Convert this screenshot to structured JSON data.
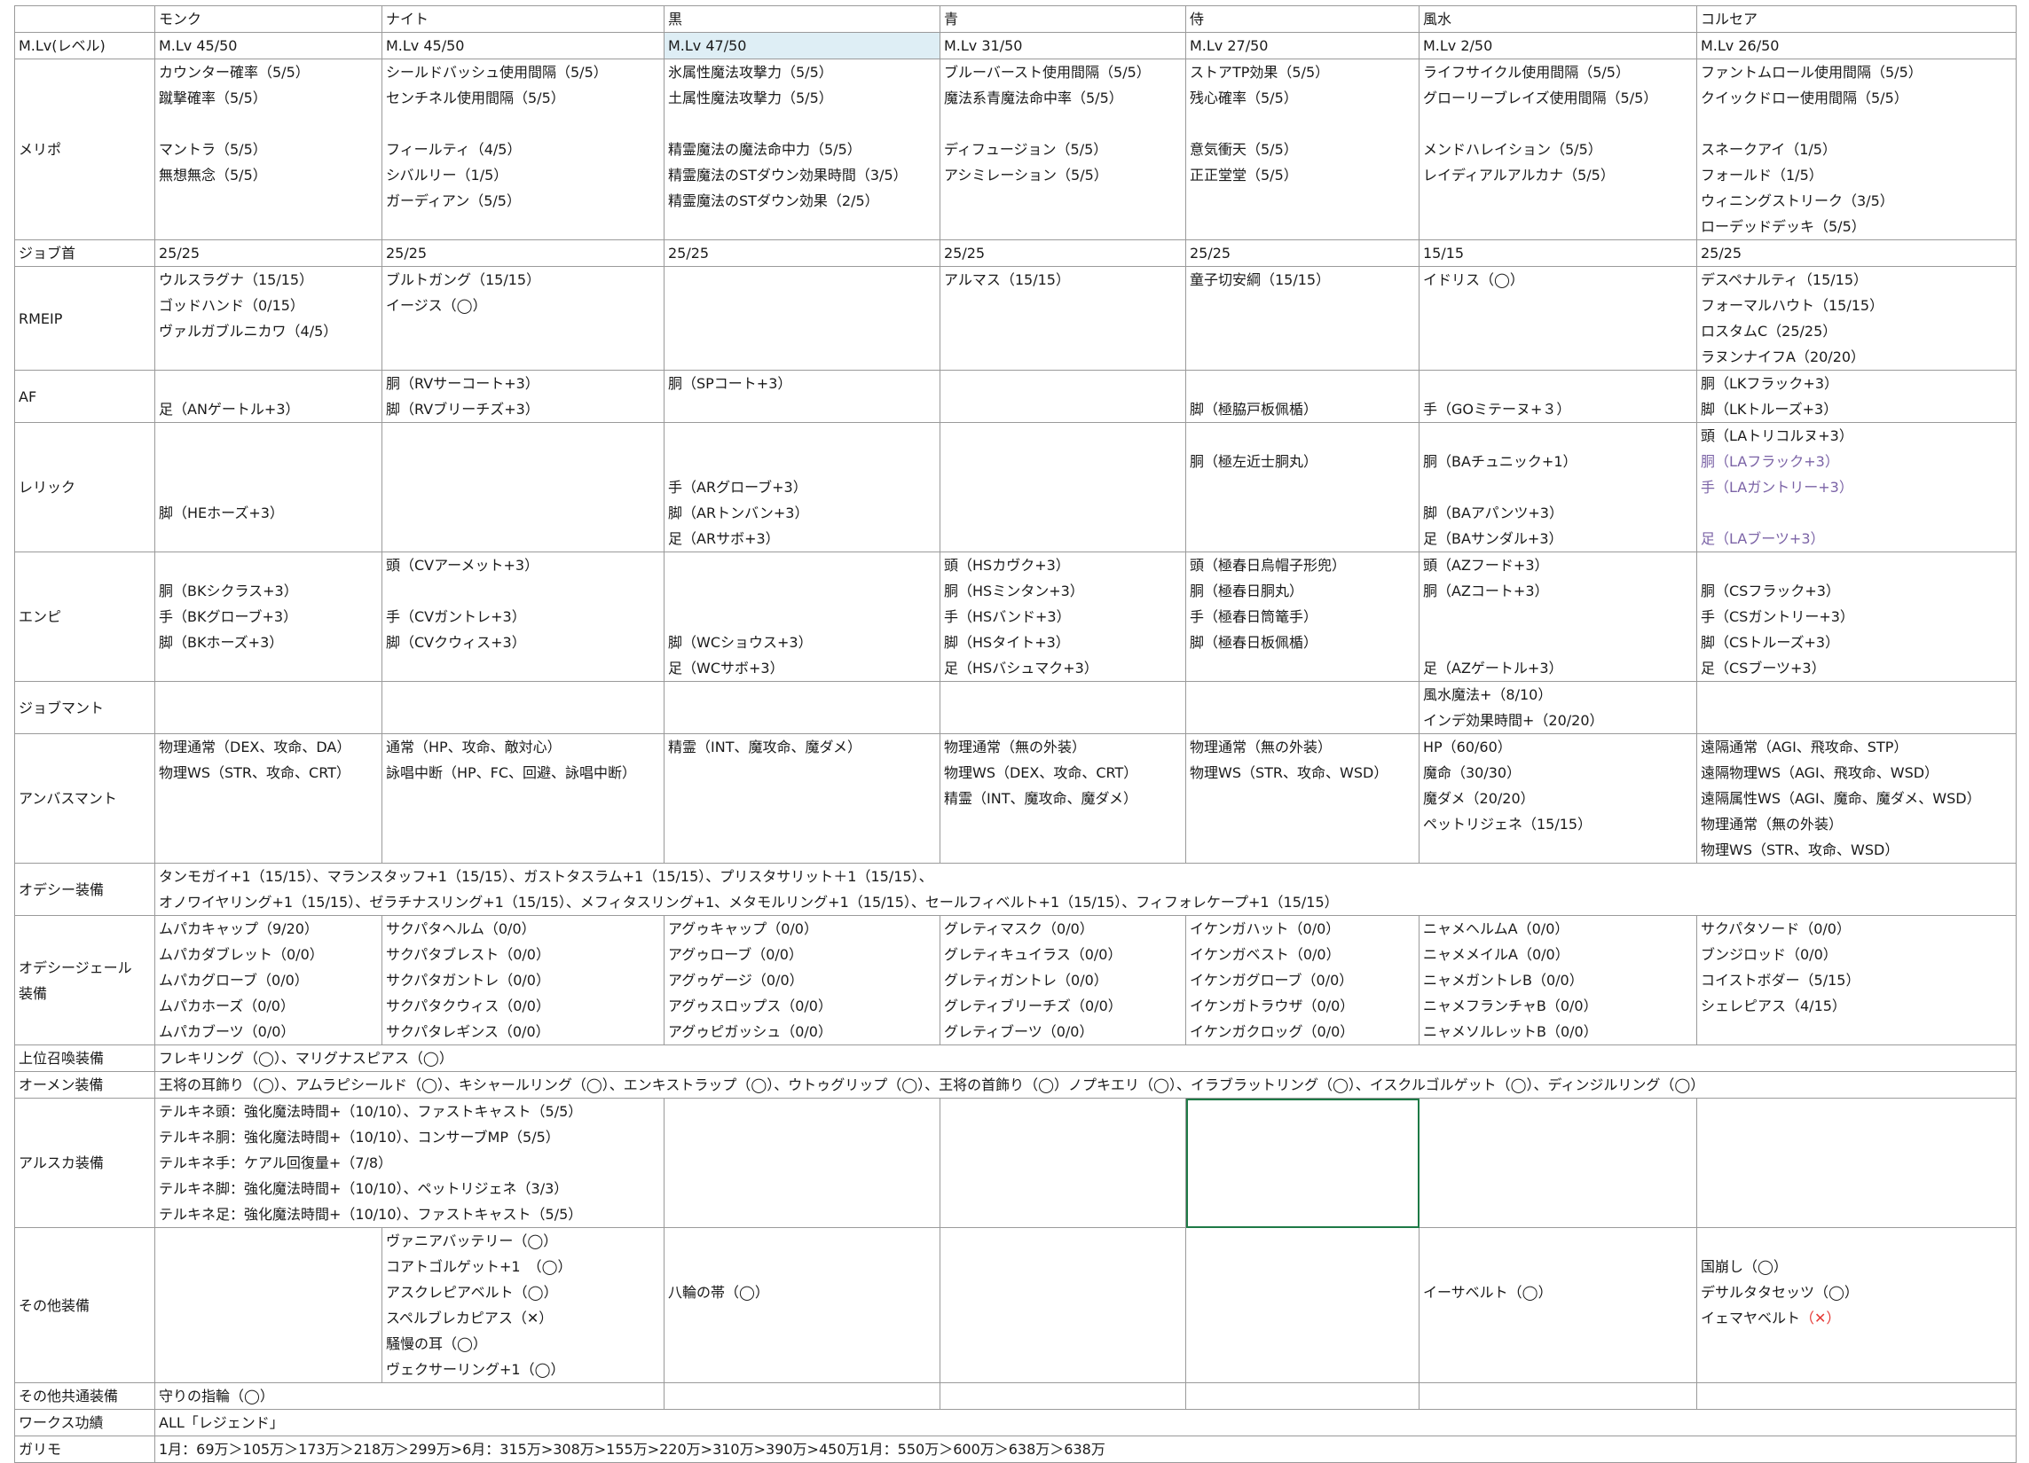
{
  "colors": {
    "highlight": "#deeef5",
    "selected_border": "#1e7a46",
    "purple_text": "#7b63a6",
    "red_mark": "#e53935",
    "grid": "#9a9a9a"
  },
  "header": {
    "corner": "",
    "jobs": [
      "モンク",
      "ナイト",
      "黒",
      "青",
      "侍",
      "風水",
      "コルセア"
    ]
  },
  "rows": [
    {
      "key": "mlv",
      "label": "M.Lv(レベル)",
      "lines": 1,
      "cells": [
        [
          "M.Lv 45/50"
        ],
        [
          "M.Lv 45/50"
        ],
        [
          "M.Lv 47/50"
        ],
        [
          "M.Lv 31/50"
        ],
        [
          "M.Lv 27/50"
        ],
        [
          "M.Lv 2/50"
        ],
        [
          "M.Lv 26/50"
        ]
      ]
    },
    {
      "key": "meripo",
      "label": "メリポ",
      "lines": 7,
      "cells": [
        [
          "カウンター確率（5/5）",
          "蹴撃確率（5/5）",
          "",
          "マントラ（5/5）",
          "無想無念（5/5）"
        ],
        [
          "シールドバッシュ使用間隔（5/5）",
          "センチネル使用間隔（5/5）",
          "",
          "フィールティ（4/5）",
          "シバルリー（1/5）",
          "ガーディアン（5/5）"
        ],
        [
          "氷属性魔法攻撃力（5/5）",
          "土属性魔法攻撃力（5/5）",
          "",
          "精霊魔法の魔法命中力（5/5）",
          "精霊魔法のSTダウン効果時間（3/5）",
          "精霊魔法のSTダウン効果（2/5）"
        ],
        [
          "ブルーバースト使用間隔（5/5）",
          "魔法系青魔法命中率（5/5）",
          "",
          "ディフュージョン（5/5）",
          "アシミレーション（5/5）"
        ],
        [
          "ストアTP効果（5/5）",
          "残心確率（5/5）",
          "",
          "意気衝天（5/5）",
          "正正堂堂（5/5）"
        ],
        [
          "ライフサイクル使用間隔（5/5）",
          "グローリーブレイズ使用間隔（5/5）",
          "",
          "メンドハレイション（5/5）",
          "レイディアルアルカナ（5/5）"
        ],
        [
          "ファントムロール使用間隔（5/5）",
          "クイックドロー使用間隔（5/5）",
          "",
          "スネークアイ（1/5）",
          "フォールド（1/5）",
          "ウィニングストリーク（3/5）",
          "ローデッドデッキ（5/5）"
        ]
      ]
    },
    {
      "key": "jobkubi",
      "label": "ジョブ首",
      "lines": 1,
      "cells": [
        [
          "25/25"
        ],
        [
          "25/25"
        ],
        [
          "25/25"
        ],
        [
          "25/25"
        ],
        [
          "25/25"
        ],
        [
          "15/15"
        ],
        [
          "25/25"
        ]
      ]
    },
    {
      "key": "rmeip",
      "label": "RMEIP",
      "lines": 4,
      "cells": [
        [
          "ウルスラグナ（15/15）",
          "ゴッドハンド（0/15）",
          "ヴァルガブルニカワ（4/5）"
        ],
        [
          "ブルトガング（15/15）",
          "イージス（◯）"
        ],
        [],
        [
          "アルマス（15/15）"
        ],
        [
          "童子切安綱（15/15）"
        ],
        [
          "イドリス（◯）"
        ],
        [
          "デスペナルティ（15/15）",
          "フォーマルハウト（15/15）",
          "ロスタムC（25/25）",
          "ラヌンナイフA（20/20）"
        ]
      ]
    },
    {
      "key": "af",
      "label": "AF",
      "lines": 2,
      "cells": [
        [
          "",
          "足（ANゲートル+3）"
        ],
        [
          "胴（RVサーコート+3）",
          "脚（RVブリーチズ+3）"
        ],
        [
          "胴（SPコート+3）",
          ""
        ],
        [],
        [
          "",
          "脚（極脇戸板佩楯）"
        ],
        [
          "",
          "手（GOミテーヌ+３）"
        ],
        [
          "胴（LKフラック+3）",
          "脚（LKトルーズ+3）"
        ]
      ]
    },
    {
      "key": "relic",
      "label": "レリック",
      "lines": 5,
      "cells": [
        [
          "",
          "",
          "",
          "脚（HEホーズ+3）",
          ""
        ],
        [],
        [
          "",
          "",
          "手（ARグローブ+3）",
          "脚（ARトンバン+3）",
          "足（ARサボ+3）"
        ],
        [],
        [
          "",
          "胴（極左近士胴丸）",
          "",
          "",
          ""
        ],
        [
          "",
          "胴（BAチュニック+1）",
          "",
          "脚（BAアパンツ+3）",
          "足（BAサンダル+3）"
        ],
        [
          "頭（LAトリコルヌ+3）",
          "§胴（LAフラック+3）",
          "§手（LAガントリー+3）",
          "",
          "§足（LAブーツ+3）"
        ]
      ]
    },
    {
      "key": "empy",
      "label": "エンピ",
      "lines": 5,
      "cells": [
        [
          "",
          "胴（BKシクラス+3）",
          "手（BKグローブ+3）",
          "脚（BKホーズ+3）",
          ""
        ],
        [
          "頭（CVアーメット+3）",
          "",
          "手（CVガントレ+3）",
          "脚（CVクウィス+3）",
          ""
        ],
        [
          "",
          "",
          "",
          "脚（WCショウス+3）",
          "足（WCサボ+3）"
        ],
        [
          "頭（HSカヴク+3）",
          "胴（HSミンタン+3）",
          "手（HSバンド+3）",
          "脚（HSタイト+3）",
          "足（HSバシュマク+3）"
        ],
        [
          "頭（極春日烏帽子形兜）",
          "胴（極春日胴丸）",
          "手（極春日筒篭手）",
          "脚（極春日板佩楯）",
          ""
        ],
        [
          "頭（AZフード+3）",
          "胴（AZコート+3）",
          "",
          "",
          "足（AZゲートル+3）"
        ],
        [
          "",
          "胴（CSフラック+3）",
          "手（CSガントリー+3）",
          "脚（CSトルーズ+3）",
          "足（CSブーツ+3）"
        ]
      ]
    },
    {
      "key": "jobmant",
      "label": "ジョブマント",
      "lines": 2,
      "cells": [
        [],
        [],
        [],
        [],
        [],
        [
          "風水魔法+（8/10）",
          "インデ効果時間+（20/20）"
        ],
        []
      ]
    },
    {
      "key": "ambus",
      "label": "アンバスマント",
      "lines": 5,
      "cells": [
        [
          "物理通常（DEX、攻命、DA）",
          "物理WS（STR、攻命、CRT）"
        ],
        [
          "通常（HP、攻命、敵対心）",
          "詠唱中断（HP、FC、回避、詠唱中断）"
        ],
        [
          "精霊（INT、魔攻命、魔ダメ）"
        ],
        [
          "物理通常（無の外装）",
          "物理WS（DEX、攻命、CRT）",
          "精霊（INT、魔攻命、魔ダメ）"
        ],
        [
          "物理通常（無の外装）",
          "物理WS（STR、攻命、WSD）"
        ],
        [
          "HP（60/60）",
          "魔命（30/30）",
          "魔ダメ（20/20）",
          "ペットリジェネ（15/15）"
        ],
        [
          "遠隔通常（AGI、飛攻命、STP）",
          "遠隔物理WS（AGI、飛攻命、WSD）",
          "遠隔属性WS（AGI、魔命、魔ダメ、WSD）",
          "物理通常（無の外装）",
          "物理WS（STR、攻命、WSD）"
        ]
      ]
    },
    {
      "key": "odyssey",
      "label": "オデシー装備",
      "lines": 2,
      "wide": true,
      "text": [
        "タンモガイ+1（15/15）、マランスタッフ+1（15/15）、ガストタスラム+1（15/15）、プリスタサリット＋1（15/15）、",
        "オノワイヤリング+1（15/15）、ゼラチナスリング+1（15/15）、メフィタスリング+1、メタモルリング+1（15/15）、セールフィベルト+1（15/15）、フィフォレケープ+1（15/15）"
      ]
    },
    {
      "key": "odyssey_gear",
      "label": [
        "オデシージェール",
        "装備"
      ],
      "lines": 5,
      "cells": [
        [
          "ムパカキャップ（9/20）",
          "ムパカダブレット（0/0）",
          "ムパカグローブ（0/0）",
          "ムパカホーズ（0/0）",
          "ムパカブーツ（0/0）"
        ],
        [
          "サクパタヘルム（0/0）",
          "サクパタブレスト（0/0）",
          "サクパタガントレ（0/0）",
          "サクパタクウィス（0/0）",
          "サクパタレギンス（0/0）"
        ],
        [
          "アグゥキャップ（0/0）",
          "アグゥローブ（0/0）",
          "アグゥゲージ（0/0）",
          "アグゥスロップス（0/0）",
          "アグゥピガッシュ（0/0）"
        ],
        [
          "グレティマスク（0/0）",
          "グレティキュイラス（0/0）",
          "グレティガントレ（0/0）",
          "グレティブリーチズ（0/0）",
          "グレティブーツ（0/0）"
        ],
        [
          "イケンガハット（0/0）",
          "イケンガベスト（0/0）",
          "イケンガグローブ（0/0）",
          "イケンガトラウザ（0/0）",
          "イケンガクロッグ（0/0）"
        ],
        [
          "ニャメヘルムA（0/0）",
          "ニャメメイルA（0/0）",
          "ニャメガントレB（0/0）",
          "ニャメフランチャB（0/0）",
          "ニャメソルレットB（0/0）"
        ],
        [
          "サクパタソード（0/0）",
          "ブンジロッド（0/0）",
          "コイストボダー（5/15）",
          "シェレピアス（4/15）",
          ""
        ]
      ]
    },
    {
      "key": "summon",
      "label": "上位召喚装備",
      "lines": 1,
      "wide": true,
      "text": [
        "フレキリング（◯）、マリグナスピアス（◯）"
      ]
    },
    {
      "key": "omen",
      "label": "オーメン装備",
      "lines": 1,
      "wide": true,
      "text": [
        "王将の耳飾り（◯）、アムラピシールド（◯）、キシャールリング（◯）、エンキストラップ（◯）、ウトゥグリップ（◯）、王将の首飾り（◯）ノプキエリ（◯）、イラブラットリング（◯）、イスクルゴルゲット（◯）、ディンジルリング（◯）"
      ]
    },
    {
      "key": "alska",
      "label": "アルスカ装備",
      "lines": 5,
      "alska": [
        "テルキネ頭：強化魔法時間+（10/10）、ファストキャスト（5/5）",
        "テルキネ胴：強化魔法時間+（10/10）、コンサーブMP（5/5）",
        "テルキネ手：ケアル回復量+（7/8）",
        "テルキネ脚：強化魔法時間+（10/10）、ペットリジェネ（3/3）",
        "テルキネ足：強化魔法時間+（10/10）、ファストキャスト（5/5）"
      ]
    },
    {
      "key": "other",
      "label": "その他装備",
      "lines": 6,
      "cells": [
        [],
        [
          "ヴァニアバッテリー（◯）",
          "コアトゴルゲット+1　（◯）",
          "アスクレピアベルト（◯）",
          "スペルブレカピアス（✕）",
          "騒慢の耳（◯）",
          "ヴェクサーリング+1（◯）"
        ],
        [
          "",
          "",
          "八輪の帯（◯）",
          "",
          "",
          ""
        ],
        [],
        [],
        [
          "",
          "",
          "イーサベルト（◯）",
          "",
          "",
          ""
        ],
        [
          "",
          "国崩し（◯）",
          "デサルタタセッツ（◯）",
          "イェマヤベルト§（✕）",
          "",
          ""
        ]
      ]
    },
    {
      "key": "common",
      "label": "その他共通装備",
      "lines": 1,
      "span2": true,
      "text": [
        "守りの指輪（◯）"
      ]
    },
    {
      "key": "works",
      "label": "ワークス功績",
      "lines": 1,
      "wide": true,
      "text": [
        "ALL「レジェンド」"
      ]
    },
    {
      "key": "garimo",
      "label": "ガリモ",
      "lines": 1,
      "wide": true,
      "text": [
        "1月：69万＞105万＞173万＞218万＞299万>6月：315万>308万>155万>220万>310万>390万>450万1月：550万＞600万＞638万＞638万"
      ]
    }
  ]
}
